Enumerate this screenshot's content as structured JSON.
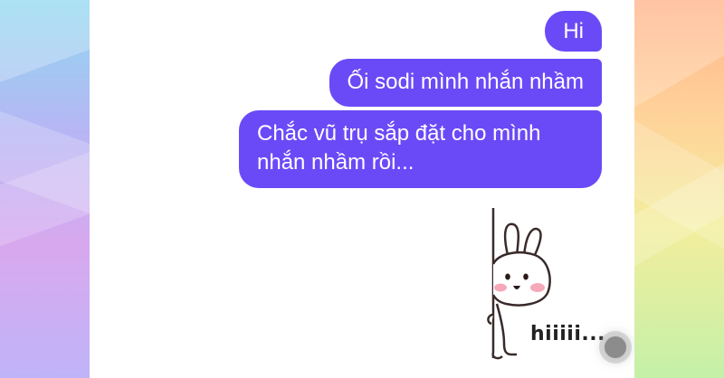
{
  "messages": [
    {
      "text": "Hi",
      "sender": "me"
    },
    {
      "text": "Ối sodi mình nhắn nhầm",
      "sender": "me"
    },
    {
      "text": "Chắc vũ trụ sắp đặt cho mình nhắn nhầm rồi...",
      "sender": "me"
    }
  ],
  "sticker": {
    "caption": "hiiiii...",
    "icon": "bunny-peeking-sticker"
  },
  "colors": {
    "bubble": "#6a4af7",
    "bubble_text": "#ffffff",
    "chat_bg": "#ffffff"
  }
}
